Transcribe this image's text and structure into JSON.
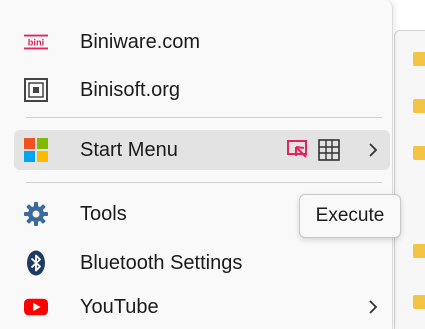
{
  "menu": {
    "items": [
      {
        "label": "Biniware.com",
        "icon": "biniware-logo-icon"
      },
      {
        "label": "Binisoft.org",
        "icon": "binisoft-logo-icon"
      },
      {
        "label": "Start Menu",
        "icon": "windows-start-icon",
        "has_submenu": true,
        "highlighted": true
      },
      {
        "label": "Tools",
        "icon": "gear-icon"
      },
      {
        "label": "Bluetooth Settings",
        "icon": "bluetooth-icon"
      },
      {
        "label": "YouTube",
        "icon": "youtube-icon",
        "has_submenu": true
      }
    ],
    "start_menu_actions": [
      {
        "icon": "execute-icon",
        "color": "#e0245e"
      },
      {
        "icon": "grid-icon",
        "color": "#333333"
      }
    ],
    "biniware_logo_text": "bini"
  },
  "tooltip": {
    "text": "Execute"
  },
  "colors": {
    "menu_bg": "#f9f9f9",
    "hover_bg": "#e3e3e3",
    "folder": "#f3c344",
    "brand_red": "#e0245e",
    "youtube_red": "#ff0000",
    "bluetooth": "#1f3a63"
  }
}
